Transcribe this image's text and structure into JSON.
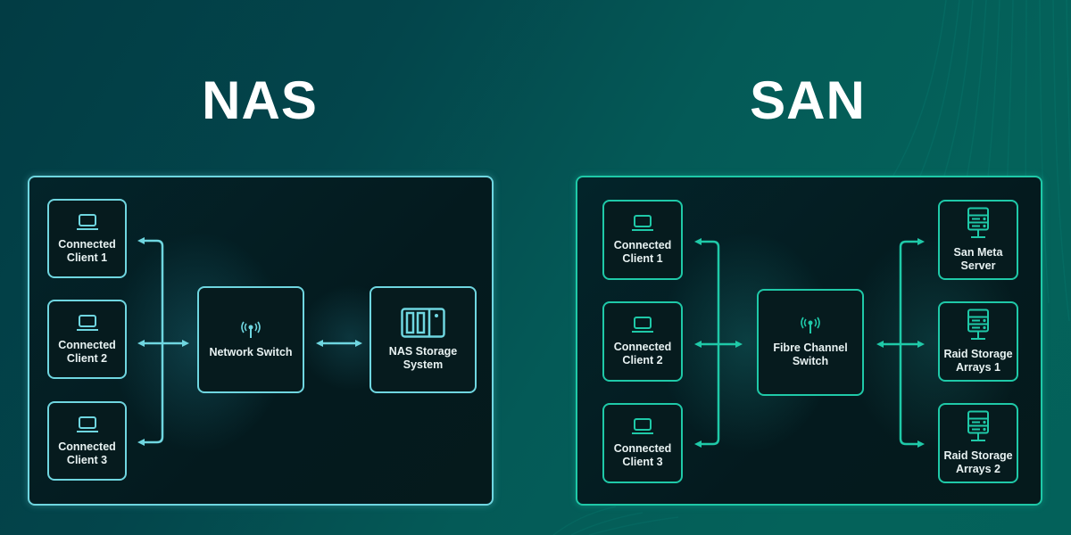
{
  "colors": {
    "nas_accent": "#6fd6e0",
    "san_accent": "#1fc9a8",
    "background": "#045a57",
    "panel": "#041a1e",
    "text": "#ffffff"
  },
  "nas": {
    "title": "NAS",
    "clients": [
      {
        "label_1": "Connected",
        "label_2": "Client 1",
        "icon": "laptop-icon"
      },
      {
        "label_1": "Connected",
        "label_2": "Client 2",
        "icon": "laptop-icon"
      },
      {
        "label_1": "Connected",
        "label_2": "Client 3",
        "icon": "laptop-icon"
      }
    ],
    "switch": {
      "label_1": "Network Switch",
      "label_2": "",
      "icon": "antenna-icon"
    },
    "storage": {
      "label_1": "NAS Storage",
      "label_2": "System",
      "icon": "storage-rack-icon"
    }
  },
  "san": {
    "title": "SAN",
    "clients": [
      {
        "label_1": "Connected",
        "label_2": "Client 1",
        "icon": "laptop-icon"
      },
      {
        "label_1": "Connected",
        "label_2": "Client 2",
        "icon": "laptop-icon"
      },
      {
        "label_1": "Connected",
        "label_2": "Client 3",
        "icon": "laptop-icon"
      }
    ],
    "switch": {
      "label_1": "Fibre Channel",
      "label_2": "Switch",
      "icon": "antenna-icon"
    },
    "servers": [
      {
        "label_1": "San Meta",
        "label_2": "Server",
        "icon": "server-icon"
      },
      {
        "label_1": "Raid Storage",
        "label_2": "Arrays 1",
        "icon": "server-icon"
      },
      {
        "label_1": "Raid Storage",
        "label_2": "Arrays 2",
        "icon": "server-icon"
      }
    ]
  }
}
